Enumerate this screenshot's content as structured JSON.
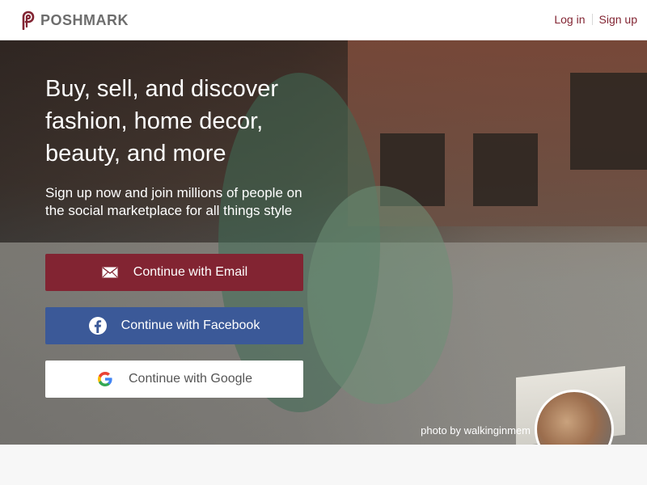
{
  "brand": {
    "name": "POSHMARK",
    "icon": "poshmark-logo-icon",
    "accent_color": "#822432"
  },
  "header": {
    "login_label": "Log in",
    "signup_label": "Sign up"
  },
  "hero": {
    "headline": "Buy, sell, and discover fashion, home decor, beauty, and more",
    "subline": "Sign up now and join millions of people on the social marketplace for all things style",
    "buttons": {
      "email_label": "Continue with Email",
      "facebook_label": "Continue with Facebook",
      "google_label": "Continue with Google"
    },
    "colors": {
      "email_button": "#822432",
      "facebook_button": "#3b5998",
      "google_button": "#ffffff"
    },
    "photo_credit": "photo by walkinginmem"
  }
}
